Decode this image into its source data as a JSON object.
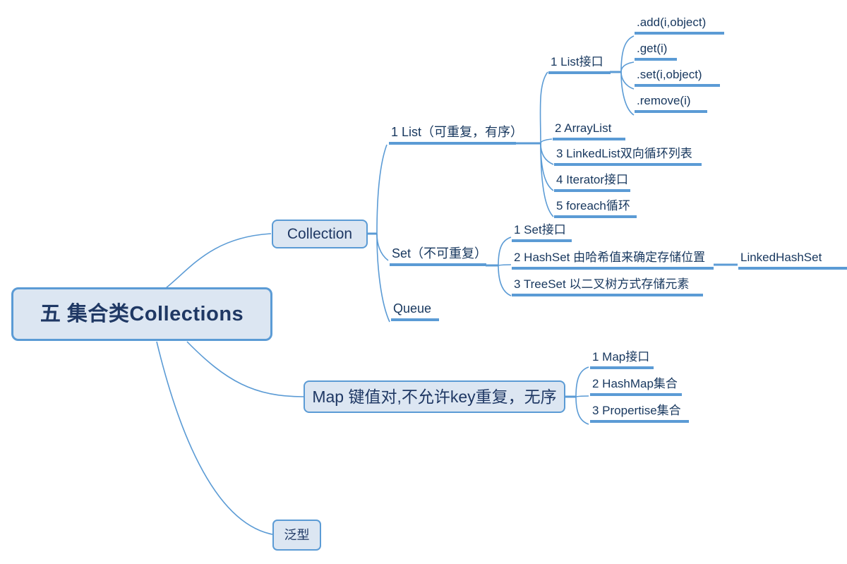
{
  "diagram": {
    "title": "五 集合类Collections",
    "type": "mind-map",
    "colors": {
      "node_fill": "#dce6f2",
      "node_border": "#5b9bd5",
      "text": "#1f3864",
      "link": "#5b9bd5",
      "background": "#ffffff"
    }
  },
  "root": {
    "label": "五 集合类Collections"
  },
  "branches": {
    "collection": {
      "label": "Collection",
      "children": {
        "list": {
          "label": "1 List（可重复，有序）",
          "children": [
            {
              "label": "1 List接口",
              "methods": [
                {
                  "label": ".add(i,object)"
                },
                {
                  "label": ".get(i)"
                },
                {
                  "label": ".set(i,object)"
                },
                {
                  "label": ".remove(i)"
                }
              ]
            },
            {
              "label": "2 ArrayList"
            },
            {
              "label": "3 LinkedList双向循环列表"
            },
            {
              "label": "4 Iterator接口"
            },
            {
              "label": "5 foreach循环"
            }
          ]
        },
        "set": {
          "label": "Set（不可重复）",
          "children": [
            {
              "label": "1 Set接口"
            },
            {
              "label": "2 HashSet 由哈希值来确定存储位置",
              "child": {
                "label": "LinkedHashSet"
              }
            },
            {
              "label": "3 TreeSet 以二叉树方式存储元素"
            }
          ]
        },
        "queue": {
          "label": "Queue"
        }
      }
    },
    "map": {
      "label": "Map 键值对,不允许key重复，无序",
      "children": [
        {
          "label": "1 Map接口"
        },
        {
          "label": "2 HashMap集合"
        },
        {
          "label": "3 Propertise集合"
        }
      ]
    },
    "generics": {
      "label": "泛型"
    }
  }
}
